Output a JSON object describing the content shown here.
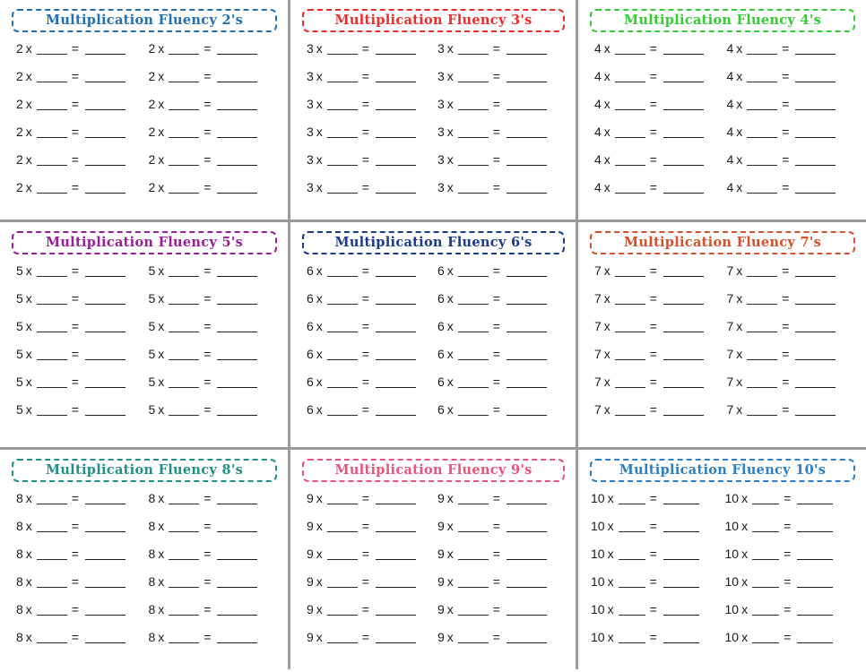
{
  "page": {
    "kind": "multiplication-fluency-worksheet-set",
    "columns_per_panel": 2,
    "rows_per_panel": 6,
    "problems_per_panel": 12,
    "blank_glyph_factor": "___",
    "blank_glyph_answer": "____",
    "separator_color": "#9a9a9a",
    "page_background": "#ffffff",
    "text_color": "#1b1b1b"
  },
  "panels": [
    {
      "id": "panel-2s",
      "title": "Multiplication Fluency  2's",
      "factor": "2",
      "times_symbol": "x",
      "equals_symbol": "=",
      "color": "#1f6fb5",
      "wide": false,
      "problems": [
        "2 x ___ = ____",
        "2 x ___ = ____",
        "2 x ___ = ____",
        "2 x ___ = ____",
        "2 x ___ = ____",
        "2 x ___ = ____",
        "2 x ___ = ____",
        "2 x ___ = ____",
        "2 x ___ = ____",
        "2 x ___ = ____",
        "2 x ___ = ____",
        "2 x ___ = ____"
      ]
    },
    {
      "id": "panel-3s",
      "title": "Multiplication Fluency  3's",
      "factor": "3",
      "times_symbol": "x",
      "equals_symbol": "=",
      "color": "#ee2b2b",
      "wide": false,
      "problems": [
        "3 x ___ = ____",
        "3 x ___ = ____",
        "3 x ___ = ____",
        "3 x ___ = ____",
        "3 x ___ = ____",
        "3 x ___ = ____",
        "3 x ___ = ____",
        "3 x ___ = ____",
        "3 x ___ = ____",
        "3 x ___ = ____",
        "3 x ___ = ____",
        "3 x ___ = ____"
      ]
    },
    {
      "id": "panel-4s",
      "title": "Multiplication Fluency  4's",
      "factor": "4",
      "times_symbol": "x",
      "equals_symbol": "=",
      "color": "#33cc33",
      "wide": false,
      "problems": [
        "4 x ___ = ____",
        "4 x ___ = ____",
        "4 x ___ = ____",
        "4 x ___ = ____",
        "4 x ___ = ____",
        "4 x ___ = ____",
        "4 x ___ = ____",
        "4 x ___ = ____",
        "4 x ___ = ____",
        "4 x ___ = ____",
        "4 x ___ = ____",
        "4 x ___ = ____"
      ]
    },
    {
      "id": "panel-5s",
      "title": "Multiplication Fluency  5's",
      "factor": "5",
      "times_symbol": "x",
      "equals_symbol": "=",
      "color": "#9b1d9b",
      "wide": false,
      "problems": [
        "5 x ___ = ____",
        "5 x ___ = ____",
        "5 x ___ = ____",
        "5 x ___ = ____",
        "5 x ___ = ____",
        "5 x ___ = ____",
        "5 x ___ = ____",
        "5 x ___ = ____",
        "5 x ___ = ____",
        "5 x ___ = ____",
        "5 x ___ = ____",
        "5 x ___ = ____"
      ]
    },
    {
      "id": "panel-6s",
      "title": "Multiplication Fluency  6's",
      "factor": "6",
      "times_symbol": "x",
      "equals_symbol": "=",
      "color": "#1b3a8c",
      "wide": false,
      "problems": [
        "6 x ___ = ____",
        "6 x ___ = ____",
        "6 x ___ = ____",
        "6 x ___ = ____",
        "6 x ___ = ____",
        "6 x ___ = ____",
        "6 x ___ = ____",
        "6 x ___ = ____",
        "6 x ___ = ____",
        "6 x ___ = ____",
        "6 x ___ = ____",
        "6 x ___ = ____"
      ]
    },
    {
      "id": "panel-7s",
      "title": "Multiplication Fluency  7's",
      "factor": "7",
      "times_symbol": "x",
      "equals_symbol": "=",
      "color": "#d4502a",
      "wide": false,
      "problems": [
        "7 x ___ = ____",
        "7 x ___ = ____",
        "7 x ___ = ____",
        "7 x ___ = ____",
        "7 x ___ = ____",
        "7 x ___ = ____",
        "7 x ___ = ____",
        "7 x ___ = ____",
        "7 x ___ = ____",
        "7 x ___ = ____",
        "7 x ___ = ____",
        "7 x ___ = ____"
      ]
    },
    {
      "id": "panel-8s",
      "title": "Multiplication Fluency  8's",
      "factor": "8",
      "times_symbol": "x",
      "equals_symbol": "=",
      "color": "#1f8f87",
      "wide": false,
      "problems": [
        "8 x ___ = ____",
        "8 x ___ = ____",
        "8 x ___ = ____",
        "8 x ___ = ____",
        "8 x ___ = ____",
        "8 x ___ = ____",
        "8 x ___ = ____",
        "8 x ___ = ____",
        "8 x ___ = ____",
        "8 x ___ = ____",
        "8 x ___ = ____",
        "8 x ___ = ____"
      ]
    },
    {
      "id": "panel-9s",
      "title": "Multiplication Fluency  9's",
      "factor": "9",
      "times_symbol": "x",
      "equals_symbol": "=",
      "color": "#e8527e",
      "wide": false,
      "problems": [
        "9 x ___ = ____",
        "9 x ___ = ____",
        "9 x ___ = ____",
        "9 x ___ = ____",
        "9 x ___ = ____",
        "9 x ___ = ____",
        "9 x ___ = ____",
        "9 x ___ = ____",
        "9 x ___ = ____",
        "9 x ___ = ____",
        "9 x ___ = ____",
        "9 x ___ = ____"
      ]
    },
    {
      "id": "panel-10s",
      "title": "Multiplication Fluency  10's",
      "factor": "10",
      "times_symbol": "x",
      "equals_symbol": "=",
      "color": "#2b7fc4",
      "wide": true,
      "problems": [
        "10 x ___ = ____",
        "10 x ___ = ____",
        "10 x ___ = ____",
        "10 x ___ = ____",
        "10 x ___ = ____",
        "10 x ___ = ____",
        "10 x ___ = ____",
        "10 x ___ = ____",
        "10 x ___ = ____",
        "10 x ___ = ____",
        "10 x ___ = ____",
        "10 x ___ = ____"
      ]
    }
  ]
}
